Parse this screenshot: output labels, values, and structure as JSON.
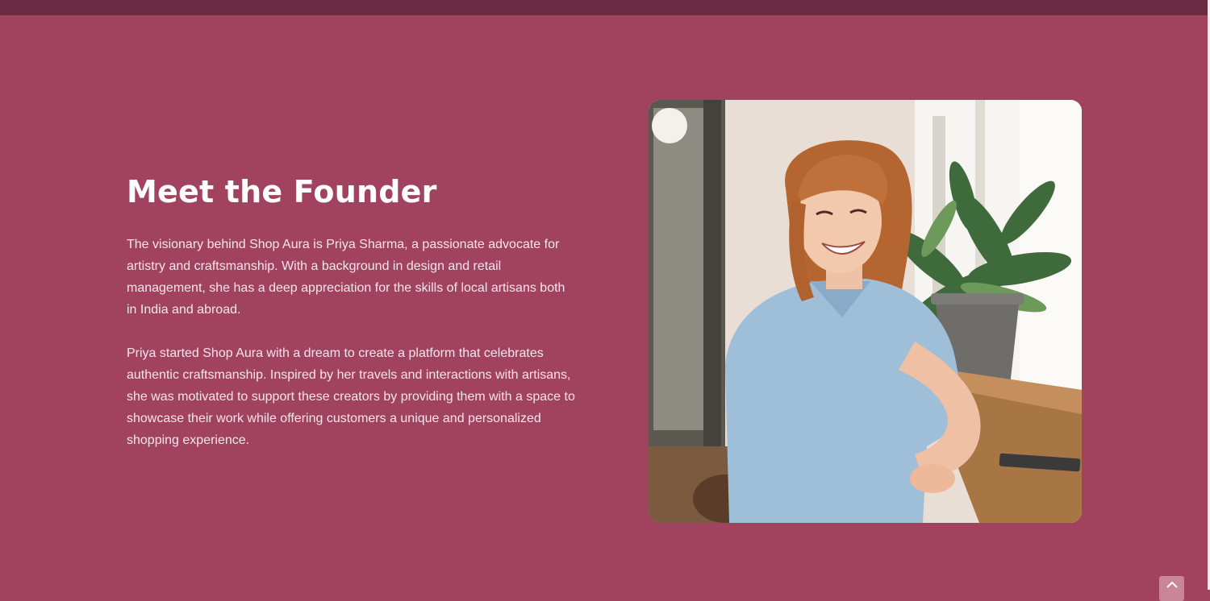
{
  "founder": {
    "title": "Meet the Founder",
    "paragraph_1": "The visionary behind Shop Aura is Priya Sharma, a passionate advocate for artistry and craftsmanship. With a background in design and retail management, she has a deep appreciation for the skills of local artisans both in India and abroad.",
    "paragraph_2": "Priya started Shop Aura with a dream to create a platform that celebrates authentic craftsmanship. Inspired by her travels and interactions with artisans, she was motivated to support these creators by providing them with a space to showcase their work while offering customers a unique and personalized shopping experience."
  },
  "colors": {
    "section_background": "#a1435f",
    "top_bar": "#6b2b43",
    "heading_text": "#ffffff",
    "body_text": "#f6e6ec",
    "back_to_top_button": "#c9859a"
  },
  "icons": {
    "back_to_top": "chevron-up-icon"
  }
}
